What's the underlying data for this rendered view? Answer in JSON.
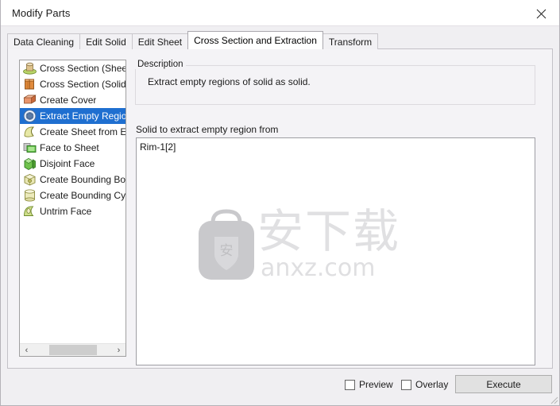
{
  "window": {
    "title": "Modify Parts",
    "close_icon": "close-icon"
  },
  "tabs": [
    {
      "label": "Data Cleaning",
      "active": false
    },
    {
      "label": "Edit Solid",
      "active": false
    },
    {
      "label": "Edit Sheet",
      "active": false
    },
    {
      "label": "Cross Section and Extraction",
      "active": true
    },
    {
      "label": "Transform",
      "active": false
    }
  ],
  "operation_list": {
    "items": [
      {
        "label": "Cross Section (Sheet)",
        "icon": "cross-section-sheet-icon",
        "selected": false
      },
      {
        "label": "Cross Section (Solid)",
        "icon": "cross-section-solid-icon",
        "selected": false
      },
      {
        "label": "Create Cover",
        "icon": "create-cover-icon",
        "selected": false
      },
      {
        "label": "Extract Empty Regions o",
        "icon": "extract-empty-regions-icon",
        "selected": true
      },
      {
        "label": "Create Sheet from Edge",
        "icon": "create-sheet-from-edge-icon",
        "selected": false
      },
      {
        "label": "Face to Sheet",
        "icon": "face-to-sheet-icon",
        "selected": false
      },
      {
        "label": "Disjoint Face",
        "icon": "disjoint-face-icon",
        "selected": false
      },
      {
        "label": "Create Bounding Box (A",
        "icon": "create-bounding-box-icon",
        "selected": false
      },
      {
        "label": "Create Bounding Cylinde",
        "icon": "create-bounding-cylinder-icon",
        "selected": false
      },
      {
        "label": "Untrim Face",
        "icon": "untrim-face-icon",
        "selected": false
      }
    ],
    "scroll_left_arrow": "‹",
    "scroll_right_arrow": "›"
  },
  "description": {
    "legend": "Description",
    "text": "Extract empty regions of solid as solid."
  },
  "solid_input": {
    "label": "Solid to extract empty region from",
    "value": "Rim-1[2]"
  },
  "watermark": {
    "chinese": "安下载",
    "latin": "anxz.com"
  },
  "footer": {
    "preview_label": "Preview",
    "preview_checked": false,
    "overlay_label": "Overlay",
    "overlay_checked": false,
    "execute_label": "Execute"
  },
  "colors": {
    "selection_blue": "#1f6fd0",
    "window_bg": "#f0eff2",
    "tab_body_bg": "#f4f3f6",
    "field_bg": "#ffffff",
    "button_bg": "#e1e1e1",
    "watermark_gray": "#e0e0e2"
  }
}
